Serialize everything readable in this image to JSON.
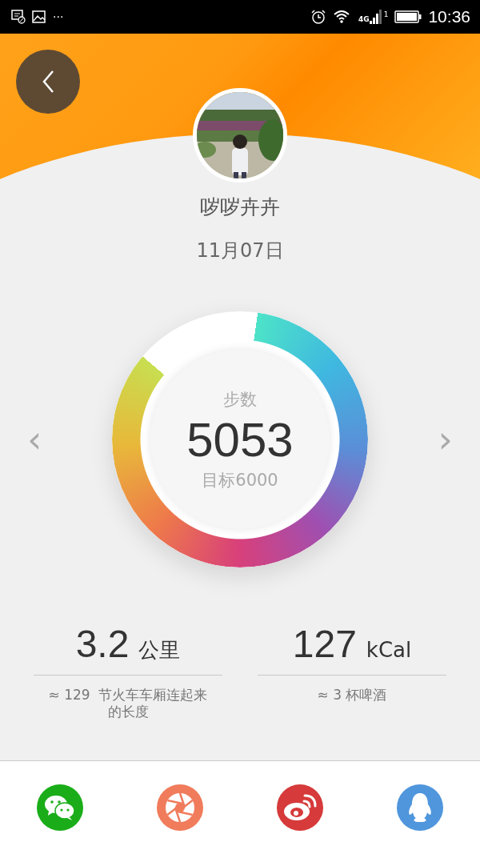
{
  "status_bar": {
    "more": "···",
    "network": "4G",
    "sim": "1",
    "time": "10:36"
  },
  "profile": {
    "name": "哕哕卉卉",
    "date": "11月07日"
  },
  "steps": {
    "label": "步数",
    "value": "5053",
    "goal": "目标6000",
    "prev": "‹",
    "next": "›"
  },
  "stats": [
    {
      "value": "3.2",
      "unit": "公里",
      "note": "≈ 129  节火车车厢连起来的长度"
    },
    {
      "value": "127",
      "unit": "kCal",
      "note": "≈ 3 杯啤酒"
    }
  ],
  "share": [
    {
      "kind": "wechat",
      "color": "#1aad19"
    },
    {
      "kind": "aperture",
      "color": "#f07c5c"
    },
    {
      "kind": "weibo",
      "color": "#d63a3a"
    },
    {
      "kind": "qq",
      "color": "#4f96dc"
    }
  ]
}
